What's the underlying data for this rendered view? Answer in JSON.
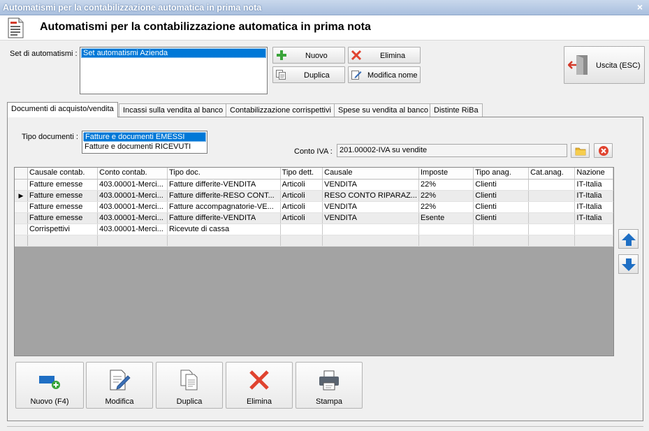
{
  "window": {
    "title": "Automatismi per la contabilizzazione automatica in prima nota",
    "close": "×"
  },
  "header": {
    "title": "Automatismi per la contabilizzazione automatica in prima nota"
  },
  "set": {
    "label": "Set di automatismi :",
    "items": [
      "Set automatismi Azienda"
    ]
  },
  "toolbar": {
    "nuovo": "Nuovo",
    "elimina": "Elimina",
    "duplica": "Duplica",
    "modifica_nome": "Modifica nome",
    "uscita": "Uscita (ESC)"
  },
  "tabs": [
    "Documenti di acquisto/vendita",
    "Incassi sulla vendita al banco",
    "Contabilizzazione corrispettivi",
    "Spese su vendita al banco",
    "Distinte RiBa"
  ],
  "tipo_documenti": {
    "label": "Tipo documenti :",
    "items": [
      "Fatture e documenti EMESSI",
      "Fatture e documenti RICEVUTI"
    ]
  },
  "conto_iva": {
    "label": "Conto IVA :",
    "value": "201.00002-IVA su vendite"
  },
  "grid": {
    "columns": [
      "Causale contab.",
      "Conto contab.",
      "Tipo doc.",
      "Tipo dett.",
      "Causale",
      "Imposte",
      "Tipo anag.",
      "Cat.anag.",
      "Nazione"
    ],
    "rows": [
      [
        "Fatture emesse",
        "403.00001-Merci...",
        "Fatture differite-VENDITA",
        "Articoli",
        "VENDITA",
        "22%",
        "Clienti",
        "",
        "IT-Italia"
      ],
      [
        "Fatture emesse",
        "403.00001-Merci...",
        "Fatture differite-RESO CONT...",
        "Articoli",
        "RESO CONTO RIPARAZ...",
        "22%",
        "Clienti",
        "",
        "IT-Italia"
      ],
      [
        "Fatture emesse",
        "403.00001-Merci...",
        "Fatture accompagnatorie-VE...",
        "Articoli",
        "VENDITA",
        "22%",
        "Clienti",
        "",
        "IT-Italia"
      ],
      [
        "Fatture emesse",
        "403.00001-Merci...",
        "Fatture differite-VENDITA",
        "Articoli",
        "VENDITA",
        "Esente",
        "Clienti",
        "",
        "IT-Italia"
      ],
      [
        "Corrispettivi",
        "403.00001-Merci...",
        "Ricevute di cassa",
        "",
        "",
        "",
        "",
        "",
        ""
      ],
      [
        "",
        "",
        "",
        "",
        "",
        "",
        "",
        "",
        ""
      ]
    ],
    "current_row_marker": "▶"
  },
  "actions": {
    "nuovo": "Nuovo (F4)",
    "modifica": "Modifica",
    "duplica": "Duplica",
    "elimina": "Elimina",
    "stampa": "Stampa"
  },
  "colors": {
    "accent": "#0078d7",
    "delete": "#e0432f",
    "add": "#3aa43a",
    "arrow": "#1f6fc4"
  }
}
